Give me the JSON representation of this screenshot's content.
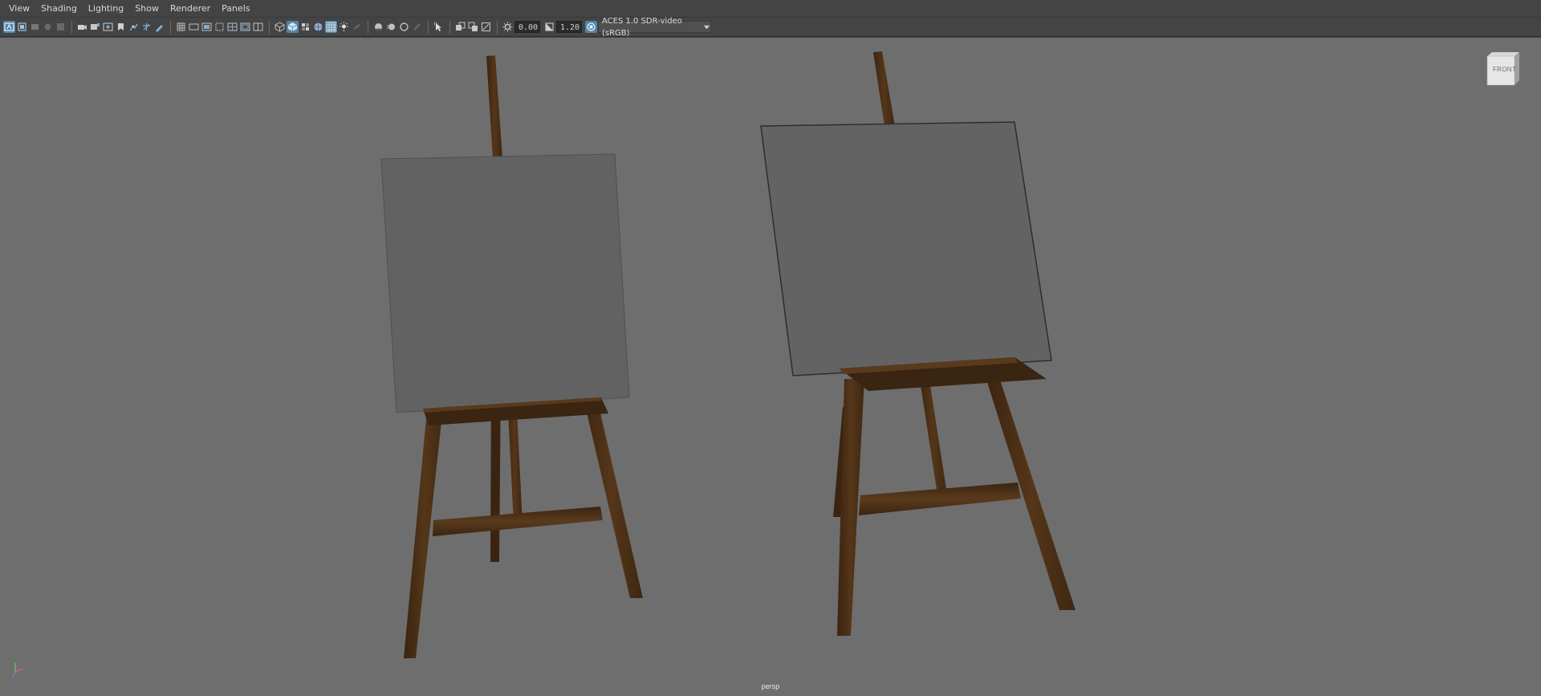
{
  "menu": {
    "items": [
      {
        "label": "View"
      },
      {
        "label": "Shading"
      },
      {
        "label": "Lighting"
      },
      {
        "label": "Show"
      },
      {
        "label": "Renderer"
      },
      {
        "label": "Panels"
      }
    ]
  },
  "toolbar": {
    "exposure_value": "0.00",
    "gamma_value": "1.20",
    "color_space": "ACES 1.0 SDR-video (sRGB)",
    "icons": [
      "select-camera-icon",
      "camera-attributes-icon",
      "bookmarks-icon",
      "image-plane-icon",
      "grid-icon",
      "film-gate-icon",
      "resolution-gate-icon",
      "gate-mask-icon",
      "field-chart-icon",
      "safe-action-icon",
      "safe-title-icon",
      "wireframe-icon",
      "smooth-shade-icon",
      "flat-shade-icon",
      "wireframe-on-shaded-icon",
      "textured-icon",
      "lighting-icon",
      "shadows-icon",
      "ambient-occlusion-icon",
      "motion-blur-icon",
      "anti-aliasing-icon",
      "depth-of-field-icon",
      "isolate-select-icon",
      "xray-icon",
      "xray-joints-icon",
      "xray-components-icon",
      "exposure-icon",
      "gamma-icon",
      "color-management-icon"
    ],
    "accent_color": "#5285a6"
  },
  "viewport": {
    "camera_name": "persp",
    "view_cube_label": "FRONT",
    "background_color": "#6e6e6e",
    "objects": [
      "easel-left",
      "easel-right"
    ]
  }
}
